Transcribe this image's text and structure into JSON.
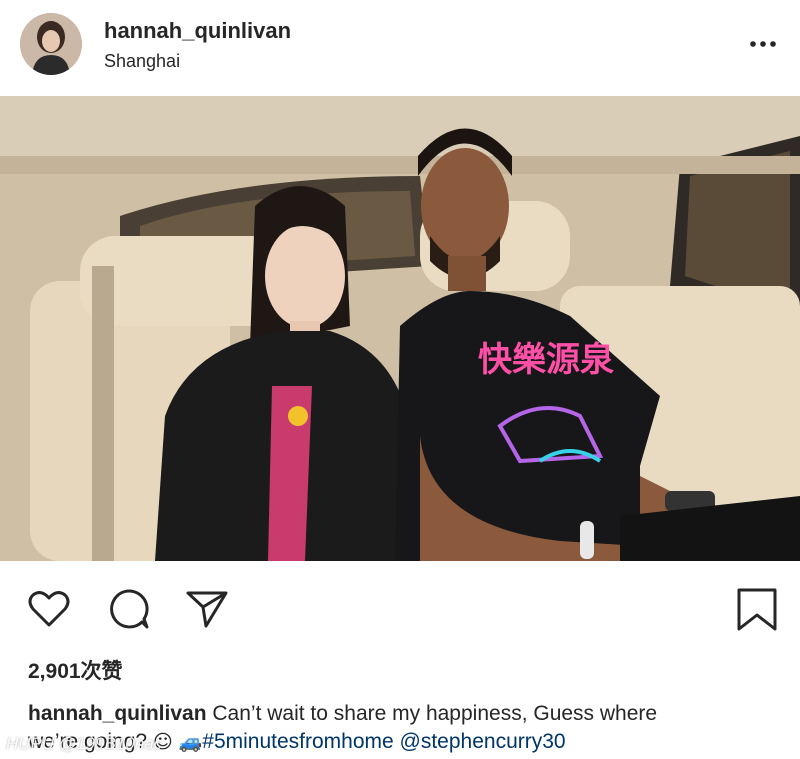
{
  "post": {
    "username": "hannah_quinlivan",
    "location": "Shanghai",
    "likes_text": "2,901次赞",
    "caption": {
      "username": "hannah_quinlivan",
      "text_line1": "Can’t wait to share my happiness, Guess where",
      "text_line2": "we’re going?",
      "emoji1": "☺",
      "emoji2": "🚙",
      "hashtag": "#5minutesfromhome",
      "mention": "@stephencurry30"
    },
    "shirt_text": "快樂源泉"
  },
  "watermark": "HUPU @199B10nac",
  "icons": {
    "more": "more-options-icon",
    "like": "heart-icon",
    "comment": "comment-icon",
    "share": "send-icon",
    "save": "bookmark-icon"
  }
}
